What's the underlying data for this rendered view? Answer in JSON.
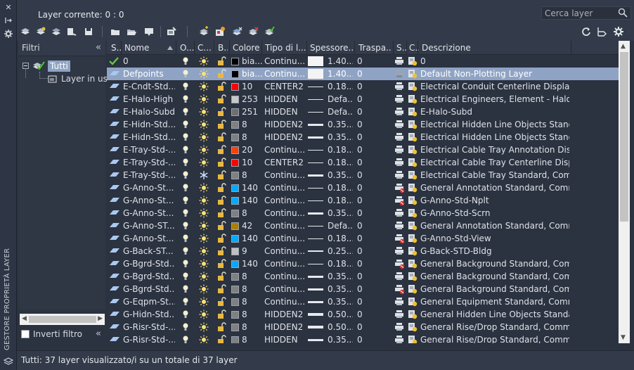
{
  "window": {
    "vertical_title": "GESTORE PROPRIETÀ LAYER",
    "current_layer": "Layer corrente: 0 : 0"
  },
  "search": {
    "placeholder": "Cerca layer"
  },
  "filters": {
    "header": "Filtri",
    "tree": [
      {
        "label": "Tutti",
        "selected": true
      },
      {
        "label": "Layer in uso",
        "selected": false
      }
    ],
    "invert_label": "Inverti filtro",
    "invert_checked": false
  },
  "columns": [
    "S..",
    "Nome",
    "O...",
    "C...",
    "B...",
    "Colore",
    "Tipo di l...",
    "Spessore...",
    "Traspa...",
    "S...",
    "C...",
    "Descrizione"
  ],
  "colors": {
    "white": "#ffffff",
    "black": "#000000",
    "red": "#ff0000",
    "grey_253": "#c8c8c8",
    "grey_251": "#6e6e6e",
    "grey_8": "#808080",
    "orange_20": "#ff3f00",
    "blue_140": "#00aaff",
    "olive_42": "#aa7f00",
    "grey_9": "#c0c0c0",
    "selection": "#8fa3c4"
  },
  "layers": [
    {
      "status": "current",
      "name": "0",
      "freeze": "sun",
      "color_name": "bia...",
      "color_hex": "#000000",
      "linetype": "Continu...",
      "lineweight_style": "box",
      "lineweight": "1.40...",
      "transparency": "0",
      "plot": "printer",
      "newvp": "newvp",
      "desc": "0",
      "selected": false
    },
    {
      "status": "layer",
      "name": "Defpoints",
      "freeze": "sun",
      "color_name": "bia...",
      "color_hex": "#000000",
      "linetype": "Continu...",
      "lineweight_style": "box",
      "lineweight": "1.40...",
      "transparency": "0",
      "plot": "noplot",
      "newvp": "newvp",
      "desc": "Default Non-Plotting Layer",
      "selected": true
    },
    {
      "status": "layer",
      "name": "E-Cndt-Std...",
      "freeze": "sun",
      "color_name": "10",
      "color_hex": "#ff0000",
      "linetype": "CENTER2",
      "lineweight_style": "thin",
      "lineweight": "0.18...",
      "transparency": "0",
      "plot": "printer",
      "newvp": "newvp",
      "desc": "Electrical Conduit Centerline Display...",
      "selected": false
    },
    {
      "status": "layer",
      "name": "E-Halo-High",
      "freeze": "sun",
      "color_name": "253",
      "color_hex": "#c8c8c8",
      "linetype": "HIDDEN",
      "lineweight_style": "thin",
      "lineweight": "Defa...",
      "transparency": "0",
      "plot": "printer",
      "newvp": "newvp",
      "desc": "Electrical Engineers, Element - Halo,...",
      "selected": false
    },
    {
      "status": "layer",
      "name": "E-Halo-Subd",
      "freeze": "sun",
      "color_name": "251",
      "color_hex": "#6e6e6e",
      "linetype": "HIDDEN",
      "lineweight_style": "thin",
      "lineweight": "Defa...",
      "transparency": "0",
      "plot": "printer",
      "newvp": "newvp",
      "desc": "E-Halo-Subd",
      "selected": false
    },
    {
      "status": "layer",
      "name": "E-Hidn-Std...",
      "freeze": "sun",
      "color_name": "8",
      "color_hex": "#808080",
      "linetype": "HIDDEN2",
      "lineweight_style": "thick",
      "lineweight": "0.35...",
      "transparency": "0",
      "plot": "printer",
      "newvp": "newvp",
      "desc": "Electrical Hidden Line Objects Standa...",
      "selected": false
    },
    {
      "status": "layer",
      "name": "E-Hidn-Std...",
      "freeze": "sun",
      "color_name": "8",
      "color_hex": "#808080",
      "linetype": "HIDDEN2",
      "lineweight_style": "thick",
      "lineweight": "0.35...",
      "transparency": "0",
      "plot": "printer",
      "newvp": "newvp",
      "desc": "Electrical Hidden Line Objects Standa...",
      "selected": false
    },
    {
      "status": "layer",
      "name": "E-Tray-Std-...",
      "freeze": "sun",
      "color_name": "20",
      "color_hex": "#ff3f00",
      "linetype": "Continu...",
      "lineweight_style": "thin",
      "lineweight": "0.18...",
      "transparency": "0",
      "plot": "printer",
      "newvp": "newvp",
      "desc": "Electrical Cable Tray Annotation Displ...",
      "selected": false
    },
    {
      "status": "layer",
      "name": "E-Tray-Std-...",
      "freeze": "sun",
      "color_name": "10",
      "color_hex": "#ff0000",
      "linetype": "CENTER2",
      "lineweight_style": "thin",
      "lineweight": "0.18...",
      "transparency": "0",
      "plot": "printer",
      "newvp": "newvp",
      "desc": "Electrical Cable Tray Centerline Displa...",
      "selected": false
    },
    {
      "status": "layer",
      "name": "E-Tray-Std-...",
      "freeze": "snow",
      "color_name": "8",
      "color_hex": "#808080",
      "linetype": "Continu...",
      "lineweight_style": "thick",
      "lineweight": "0.35...",
      "transparency": "0",
      "plot": "printer",
      "newvp": "newvp",
      "desc": "Electrical Cable Tray Standard, Comm...",
      "selected": false
    },
    {
      "status": "layer",
      "name": "G-Anno-St...",
      "freeze": "sun",
      "color_name": "140",
      "color_hex": "#00aaff",
      "linetype": "Continu...",
      "lineweight_style": "thin",
      "lineweight": "0.18...",
      "transparency": "0",
      "plot": "noplot_red",
      "newvp": "newvp",
      "desc": "General Annotation Standard, Comm...",
      "selected": false
    },
    {
      "status": "layer",
      "name": "G-Anno-St...",
      "freeze": "sun",
      "color_name": "140",
      "color_hex": "#00aaff",
      "linetype": "Continu...",
      "lineweight_style": "thin",
      "lineweight": "0.18...",
      "transparency": "0",
      "plot": "noplot_red",
      "newvp": "newvp",
      "desc": "G-Anno-Std-Nplt",
      "selected": false
    },
    {
      "status": "layer",
      "name": "G-Anno-St...",
      "freeze": "sun",
      "color_name": "8",
      "color_hex": "#808080",
      "linetype": "Continu...",
      "lineweight_style": "thick",
      "lineweight": "0.35...",
      "transparency": "0",
      "plot": "printer",
      "newvp": "newvp",
      "desc": "G-Anno-Std-Scrn",
      "selected": false
    },
    {
      "status": "layer",
      "name": "G-Anno-ST...",
      "freeze": "sun",
      "color_name": "42",
      "color_hex": "#aa7f00",
      "linetype": "Continu...",
      "lineweight_style": "thin",
      "lineweight": "Defa...",
      "transparency": "0",
      "plot": "printer",
      "newvp": "newvp",
      "desc": "General Annotation Standard, Comm...",
      "selected": false
    },
    {
      "status": "layer",
      "name": "G-Anno-St...",
      "freeze": "sun",
      "color_name": "140",
      "color_hex": "#00aaff",
      "linetype": "Continu...",
      "lineweight_style": "thin",
      "lineweight": "0.18...",
      "transparency": "0",
      "plot": "noplot_red",
      "newvp": "newvp",
      "desc": "G-Anno-Std-View",
      "selected": false
    },
    {
      "status": "layer",
      "name": "G-Back-ST...",
      "freeze": "sun",
      "color_name": "9",
      "color_hex": "#c0c0c0",
      "linetype": "Continu...",
      "lineweight_style": "mid",
      "lineweight": "0.25...",
      "transparency": "0",
      "plot": "printer",
      "newvp": "newvp",
      "desc": "G-Back-STD-Bldg",
      "selected": false
    },
    {
      "status": "layer",
      "name": "G-Bgrd-Std...",
      "freeze": "sun",
      "color_name": "140",
      "color_hex": "#00aaff",
      "linetype": "Continu...",
      "lineweight_style": "thin",
      "lineweight": "0.18...",
      "transparency": "0",
      "plot": "noplot_red",
      "newvp": "newvp",
      "desc": "General Background Standard, Com...",
      "selected": false
    },
    {
      "status": "layer",
      "name": "G-Bgrd-Std...",
      "freeze": "sun",
      "color_name": "8",
      "color_hex": "#808080",
      "linetype": "Continu...",
      "lineweight_style": "thick",
      "lineweight": "0.35...",
      "transparency": "0",
      "plot": "printer",
      "newvp": "newvp",
      "desc": "General Background Standard, Com...",
      "selected": false
    },
    {
      "status": "layer",
      "name": "G-Bgrd-Std...",
      "freeze": "sun",
      "color_name": "8",
      "color_hex": "#808080",
      "linetype": "Continu...",
      "lineweight_style": "thick",
      "lineweight": "0.35...",
      "transparency": "0",
      "plot": "noplot_red",
      "newvp": "newvp",
      "desc": "General Background Standard, Com...",
      "selected": false
    },
    {
      "status": "layer",
      "name": "G-Eqpm-St...",
      "freeze": "sun",
      "color_name": "8",
      "color_hex": "#808080",
      "linetype": "Continu...",
      "lineweight_style": "thick",
      "lineweight": "0.35...",
      "transparency": "0",
      "plot": "printer",
      "newvp": "newvp",
      "desc": "General Equipment Standard, Comm...",
      "selected": false
    },
    {
      "status": "layer",
      "name": "G-Hidn-Std...",
      "freeze": "sun",
      "color_name": "8",
      "color_hex": "#808080",
      "linetype": "HIDDEN2",
      "lineweight_style": "thicker",
      "lineweight": "0.50...",
      "transparency": "0",
      "plot": "printer",
      "newvp": "newvp",
      "desc": "General Hidden Line Objects Standar...",
      "selected": false
    },
    {
      "status": "layer",
      "name": "G-Risr-Std-...",
      "freeze": "sun",
      "color_name": "8",
      "color_hex": "#808080",
      "linetype": "HIDDEN2",
      "lineweight_style": "thicker",
      "lineweight": "0.50...",
      "transparency": "0",
      "plot": "printer",
      "newvp": "newvp",
      "desc": "General Rise/Drop Standard, Commo...",
      "selected": false
    },
    {
      "status": "layer",
      "name": "G-Risr-Std-...",
      "freeze": "sun",
      "color_name": "8",
      "color_hex": "#808080",
      "linetype": "HIDDEN",
      "lineweight_style": "thick",
      "lineweight": "0.35...",
      "transparency": "0",
      "plot": "printer",
      "newvp": "newvp",
      "desc": "General Rise/Drop Standard, Common...",
      "selected": false
    }
  ],
  "status_bar": "Tutti: 37 layer visualizzato/i su un totale di 37 layer"
}
